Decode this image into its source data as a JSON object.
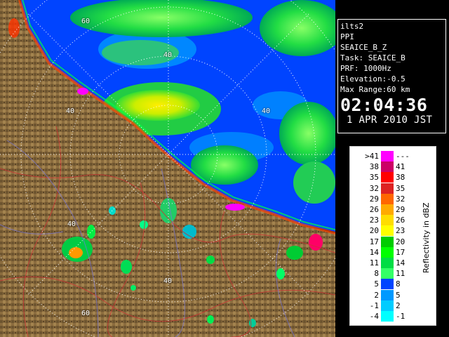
{
  "info_panel": {
    "lines": [
      "ilts2",
      "PPI",
      "SEAICE_B_Z",
      "Task: SEAICE_B",
      "PRF: 1000Hz",
      "Elevation:-0.5",
      "Max Range:60 km"
    ],
    "time": "02:04:36",
    "date": "1 APR 2010 JST"
  },
  "range_rings": {
    "labels": [
      "60",
      "40",
      "40",
      "40",
      "40",
      "40",
      "60"
    ]
  },
  "legend": {
    "unit_label": "Reflectivity in dBZ",
    "rows": [
      {
        "low": ">41",
        "high": "---",
        "color": "#ff00ff"
      },
      {
        "low": "38",
        "high": "41",
        "color": "#cc0066"
      },
      {
        "low": "35",
        "high": "38",
        "color": "#ff0000"
      },
      {
        "low": "32",
        "high": "35",
        "color": "#dd2222"
      },
      {
        "low": "29",
        "high": "32",
        "color": "#ff6600"
      },
      {
        "low": "26",
        "high": "29",
        "color": "#ffaa00"
      },
      {
        "low": "23",
        "high": "26",
        "color": "#ffdd00"
      },
      {
        "low": "20",
        "high": "23",
        "color": "#ffff00"
      },
      {
        "low": "17",
        "high": "20",
        "color": "#00cc00"
      },
      {
        "low": "14",
        "high": "17",
        "color": "#00ff00"
      },
      {
        "low": "11",
        "high": "14",
        "color": "#00dd44"
      },
      {
        "low": "8",
        "high": "11",
        "color": "#33ff66"
      },
      {
        "low": "5",
        "high": "8",
        "color": "#0044ff"
      },
      {
        "low": "2",
        "high": "5",
        "color": "#0099ff"
      },
      {
        "low": "-1",
        "high": "2",
        "color": "#00ccff"
      },
      {
        "low": "-4",
        "high": "-1",
        "color": "#00ffff"
      }
    ]
  },
  "colors": {
    "sea_ice_blue": "#0055ff",
    "land_brown": "#8a6a3a",
    "ring_color": "#ffffff"
  }
}
